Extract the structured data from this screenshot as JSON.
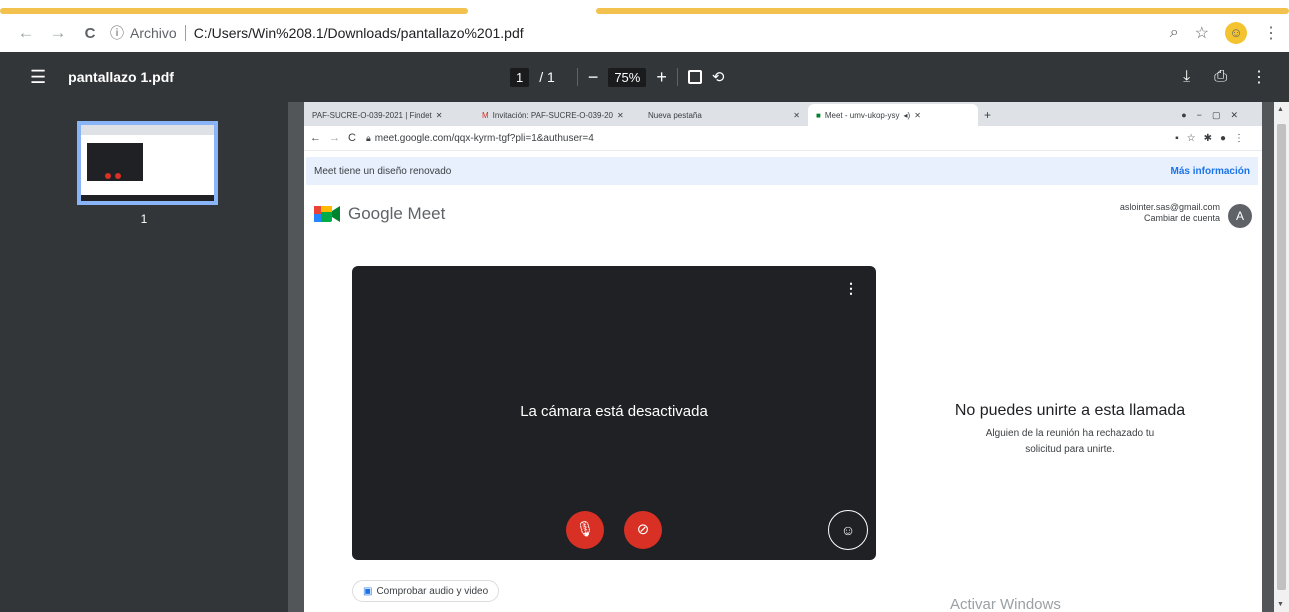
{
  "browser": {
    "nav_back": "←",
    "nav_forward": "→",
    "reload": "C",
    "info_label": "Archivo",
    "url": "C:/Users/Win%208.1/Downloads/pantallazo%201.pdf"
  },
  "pdf_toolbar": {
    "title": "pantallazo 1.pdf",
    "page_current": "1",
    "page_total": "/ 1",
    "zoom": "75%"
  },
  "sidebar": {
    "thumbnail_number": "1"
  },
  "inner_browser": {
    "tabs": [
      {
        "label": "PAF-SUCRE-O-039-2021 | Findet"
      },
      {
        "label": "Invitación: PAF-SUCRE-O-039-20"
      },
      {
        "label": "Nueva pestaña"
      },
      {
        "label": "Meet - umv-ukop-ysy"
      }
    ],
    "url": "meet.google.com/qqx-kyrm-tgf?pli=1&authuser=4"
  },
  "meet": {
    "banner_text": "Meet tiene un diseño renovado",
    "banner_link": "Más información",
    "logo_text": "Google Meet",
    "account_email": "aslointer.sas@gmail.com",
    "switch_account": "Cambiar de cuenta",
    "avatar_letter": "A",
    "camera_off": "La cámara está desactivada",
    "cant_join_title": "No puedes unirte a esta llamada",
    "cant_join_text": "Alguien de la reunión ha rechazado tu solicitud para unirte.",
    "check_audio": "Comprobar audio y video",
    "watermark": "Activar Windows"
  },
  "colors": {
    "accent_red": "#d93025",
    "meet_blue": "#1a73e8",
    "toolbar_bg": "#323639"
  }
}
